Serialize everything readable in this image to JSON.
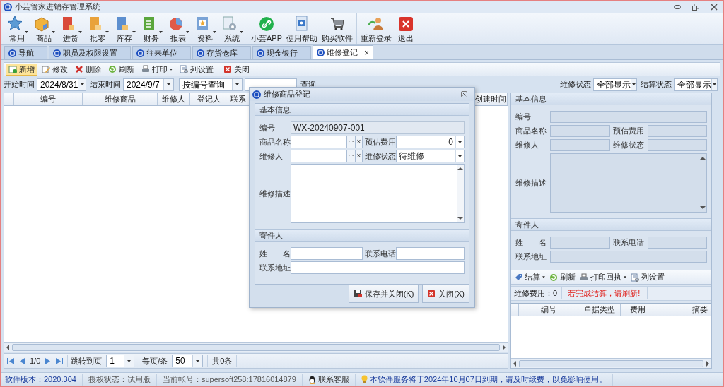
{
  "window": {
    "title": "小芸管家进销存管理系统"
  },
  "ribbon_groups": [
    [
      {
        "label": "常用",
        "menu": true
      },
      {
        "label": "商品",
        "menu": true
      },
      {
        "label": "进货",
        "menu": true
      },
      {
        "label": "批零",
        "menu": true
      },
      {
        "label": "库存",
        "menu": true
      },
      {
        "label": "财务",
        "menu": true
      },
      {
        "label": "报表",
        "menu": true
      },
      {
        "label": "资料",
        "menu": true
      },
      {
        "label": "系统",
        "menu": true
      }
    ],
    [
      {
        "label": "小芸APP",
        "menu": false
      },
      {
        "label": "使用帮助",
        "menu": false
      },
      {
        "label": "购买软件",
        "menu": false
      }
    ],
    [
      {
        "label": "重新登录",
        "menu": false
      },
      {
        "label": "退出",
        "menu": false
      }
    ]
  ],
  "tabs": [
    {
      "label": "导航",
      "selected": false
    },
    {
      "label": "职员及权限设置",
      "selected": false
    },
    {
      "label": "往来单位",
      "selected": false
    },
    {
      "label": "存货仓库",
      "selected": false
    },
    {
      "label": "现金银行",
      "selected": false
    },
    {
      "label": "维修登记",
      "selected": true,
      "close": "×"
    }
  ],
  "toolbar_groups": [
    [
      {
        "label": "新增",
        "highlighted": true,
        "menu": false
      },
      {
        "label": "修改",
        "highlighted": false,
        "menu": false
      },
      {
        "label": "删除",
        "highlighted": false,
        "menu": false
      },
      {
        "label": "刷新",
        "highlighted": false,
        "menu": false
      },
      {
        "label": "打印",
        "highlighted": false,
        "menu": true
      },
      {
        "label": "列设置",
        "highlighted": false,
        "menu": false
      }
    ],
    [
      {
        "label": "关闭",
        "highlighted": false,
        "menu": false
      }
    ]
  ],
  "filters": {
    "start_label": "开始时间",
    "start_value": "2024/8/31",
    "end_label": "结束时间",
    "end_value": "2024/9/7",
    "query_mode": "按编号查询",
    "query_button": "查询",
    "repair_status_label": "维修状态",
    "repair_status": "全部显示",
    "settle_status_label": "结算状态",
    "settle_status": "全部显示"
  },
  "grid": {
    "columns": [
      "编号",
      "维修商品",
      "维修人",
      "登记人",
      "联系",
      "创建时间"
    ]
  },
  "pager": {
    "position": "1/0",
    "goto_label": "跳转到页",
    "goto_value": "1",
    "page_size_label": "每页/条",
    "page_size": "50",
    "total": "共0条"
  },
  "detail": {
    "basic_title": "基本信息",
    "basic_rows": [
      [
        {
          "label": "编号",
          "kind": "readonly"
        }
      ],
      [
        {
          "label": "商品名称",
          "kind": "readonly"
        },
        {
          "label": "预估费用",
          "kind": "readonly"
        }
      ],
      [
        {
          "label": "维修人",
          "kind": "readonly"
        },
        {
          "label": "维修状态",
          "kind": "readonly"
        }
      ],
      [
        {
          "label": "维修描述",
          "kind": "textarea"
        }
      ]
    ],
    "sender_title": "寄件人",
    "sender_rows": [
      [
        {
          "label": "姓　　名",
          "kind": "readonly"
        },
        {
          "label": "联系电话",
          "kind": "readonly"
        }
      ],
      [
        {
          "label": "联系地址",
          "kind": "readonly"
        }
      ]
    ],
    "actions": [
      {
        "label": "结算",
        "menu": true
      },
      {
        "label": "刷新",
        "menu": false
      },
      {
        "label": "打印回执",
        "menu": true
      },
      {
        "label": "列设置",
        "menu": false
      }
    ],
    "fee": "维修费用：0",
    "notice": "若完成结算，请刷新!",
    "grid_columns": [
      "编号",
      "单据类型",
      "费用",
      "摘要"
    ]
  },
  "dialog": {
    "title": "维修商品登记",
    "basic_title": "基本信息",
    "rows": [
      [
        {
          "label": "编号",
          "kind": "readonly",
          "value": "WX-20240907-001"
        }
      ],
      [
        {
          "label": "商品名称",
          "kind": "picker",
          "browse": "···",
          "clear": "×"
        },
        {
          "label": "预估费用",
          "kind": "spin",
          "value": "0"
        }
      ],
      [
        {
          "label": "维修人",
          "kind": "picker",
          "browse": "···",
          "clear": "×"
        },
        {
          "label": "维修状态",
          "kind": "select",
          "value": "待维修"
        }
      ],
      [
        {
          "label": "维修描述",
          "kind": "textarea"
        }
      ]
    ],
    "sender_title": "寄件人",
    "sender_rows": [
      [
        {
          "label": "姓　　名",
          "kind": "text"
        },
        {
          "label": "联系电话",
          "kind": "text"
        }
      ],
      [
        {
          "label": "联系地址",
          "kind": "text"
        }
      ]
    ],
    "buttons": [
      "保存并关闭(K)",
      "关闭(X)"
    ]
  },
  "status_bar": [
    {
      "kind": "link",
      "text": "软件版本：2020.304"
    },
    {
      "kind": "text",
      "text": "授权状态：试用版"
    },
    {
      "kind": "text",
      "text": "当前帐号：supersoft258:17816014879"
    },
    {
      "kind": "support",
      "text": "联系客服"
    },
    {
      "kind": "notice",
      "text": "本软件服务将于2024年10月07日到期，请及时续费，以免影响使用。"
    }
  ]
}
